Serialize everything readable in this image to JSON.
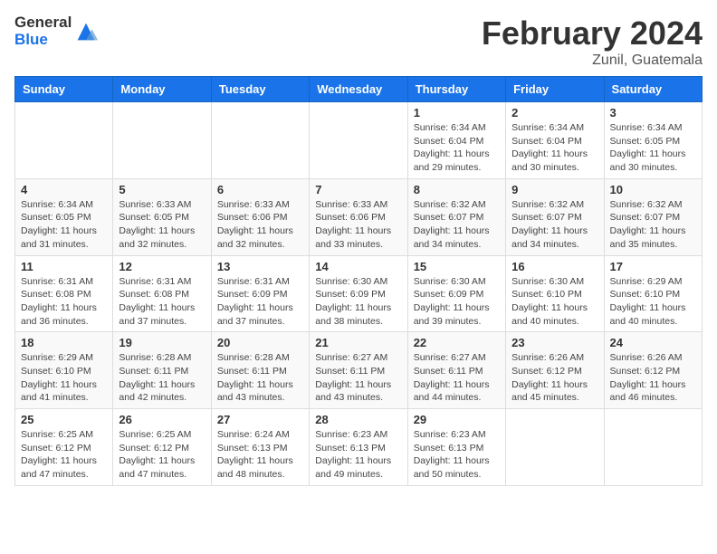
{
  "logo": {
    "general": "General",
    "blue": "Blue"
  },
  "header": {
    "month": "February 2024",
    "location": "Zunil, Guatemala"
  },
  "days_of_week": [
    "Sunday",
    "Monday",
    "Tuesday",
    "Wednesday",
    "Thursday",
    "Friday",
    "Saturday"
  ],
  "weeks": [
    [
      {
        "day": "",
        "info": ""
      },
      {
        "day": "",
        "info": ""
      },
      {
        "day": "",
        "info": ""
      },
      {
        "day": "",
        "info": ""
      },
      {
        "day": "1",
        "info": "Sunrise: 6:34 AM\nSunset: 6:04 PM\nDaylight: 11 hours and 29 minutes."
      },
      {
        "day": "2",
        "info": "Sunrise: 6:34 AM\nSunset: 6:04 PM\nDaylight: 11 hours and 30 minutes."
      },
      {
        "day": "3",
        "info": "Sunrise: 6:34 AM\nSunset: 6:05 PM\nDaylight: 11 hours and 30 minutes."
      }
    ],
    [
      {
        "day": "4",
        "info": "Sunrise: 6:34 AM\nSunset: 6:05 PM\nDaylight: 11 hours and 31 minutes."
      },
      {
        "day": "5",
        "info": "Sunrise: 6:33 AM\nSunset: 6:05 PM\nDaylight: 11 hours and 32 minutes."
      },
      {
        "day": "6",
        "info": "Sunrise: 6:33 AM\nSunset: 6:06 PM\nDaylight: 11 hours and 32 minutes."
      },
      {
        "day": "7",
        "info": "Sunrise: 6:33 AM\nSunset: 6:06 PM\nDaylight: 11 hours and 33 minutes."
      },
      {
        "day": "8",
        "info": "Sunrise: 6:32 AM\nSunset: 6:07 PM\nDaylight: 11 hours and 34 minutes."
      },
      {
        "day": "9",
        "info": "Sunrise: 6:32 AM\nSunset: 6:07 PM\nDaylight: 11 hours and 34 minutes."
      },
      {
        "day": "10",
        "info": "Sunrise: 6:32 AM\nSunset: 6:07 PM\nDaylight: 11 hours and 35 minutes."
      }
    ],
    [
      {
        "day": "11",
        "info": "Sunrise: 6:31 AM\nSunset: 6:08 PM\nDaylight: 11 hours and 36 minutes."
      },
      {
        "day": "12",
        "info": "Sunrise: 6:31 AM\nSunset: 6:08 PM\nDaylight: 11 hours and 37 minutes."
      },
      {
        "day": "13",
        "info": "Sunrise: 6:31 AM\nSunset: 6:09 PM\nDaylight: 11 hours and 37 minutes."
      },
      {
        "day": "14",
        "info": "Sunrise: 6:30 AM\nSunset: 6:09 PM\nDaylight: 11 hours and 38 minutes."
      },
      {
        "day": "15",
        "info": "Sunrise: 6:30 AM\nSunset: 6:09 PM\nDaylight: 11 hours and 39 minutes."
      },
      {
        "day": "16",
        "info": "Sunrise: 6:30 AM\nSunset: 6:10 PM\nDaylight: 11 hours and 40 minutes."
      },
      {
        "day": "17",
        "info": "Sunrise: 6:29 AM\nSunset: 6:10 PM\nDaylight: 11 hours and 40 minutes."
      }
    ],
    [
      {
        "day": "18",
        "info": "Sunrise: 6:29 AM\nSunset: 6:10 PM\nDaylight: 11 hours and 41 minutes."
      },
      {
        "day": "19",
        "info": "Sunrise: 6:28 AM\nSunset: 6:11 PM\nDaylight: 11 hours and 42 minutes."
      },
      {
        "day": "20",
        "info": "Sunrise: 6:28 AM\nSunset: 6:11 PM\nDaylight: 11 hours and 43 minutes."
      },
      {
        "day": "21",
        "info": "Sunrise: 6:27 AM\nSunset: 6:11 PM\nDaylight: 11 hours and 43 minutes."
      },
      {
        "day": "22",
        "info": "Sunrise: 6:27 AM\nSunset: 6:11 PM\nDaylight: 11 hours and 44 minutes."
      },
      {
        "day": "23",
        "info": "Sunrise: 6:26 AM\nSunset: 6:12 PM\nDaylight: 11 hours and 45 minutes."
      },
      {
        "day": "24",
        "info": "Sunrise: 6:26 AM\nSunset: 6:12 PM\nDaylight: 11 hours and 46 minutes."
      }
    ],
    [
      {
        "day": "25",
        "info": "Sunrise: 6:25 AM\nSunset: 6:12 PM\nDaylight: 11 hours and 47 minutes."
      },
      {
        "day": "26",
        "info": "Sunrise: 6:25 AM\nSunset: 6:12 PM\nDaylight: 11 hours and 47 minutes."
      },
      {
        "day": "27",
        "info": "Sunrise: 6:24 AM\nSunset: 6:13 PM\nDaylight: 11 hours and 48 minutes."
      },
      {
        "day": "28",
        "info": "Sunrise: 6:23 AM\nSunset: 6:13 PM\nDaylight: 11 hours and 49 minutes."
      },
      {
        "day": "29",
        "info": "Sunrise: 6:23 AM\nSunset: 6:13 PM\nDaylight: 11 hours and 50 minutes."
      },
      {
        "day": "",
        "info": ""
      },
      {
        "day": "",
        "info": ""
      }
    ]
  ]
}
